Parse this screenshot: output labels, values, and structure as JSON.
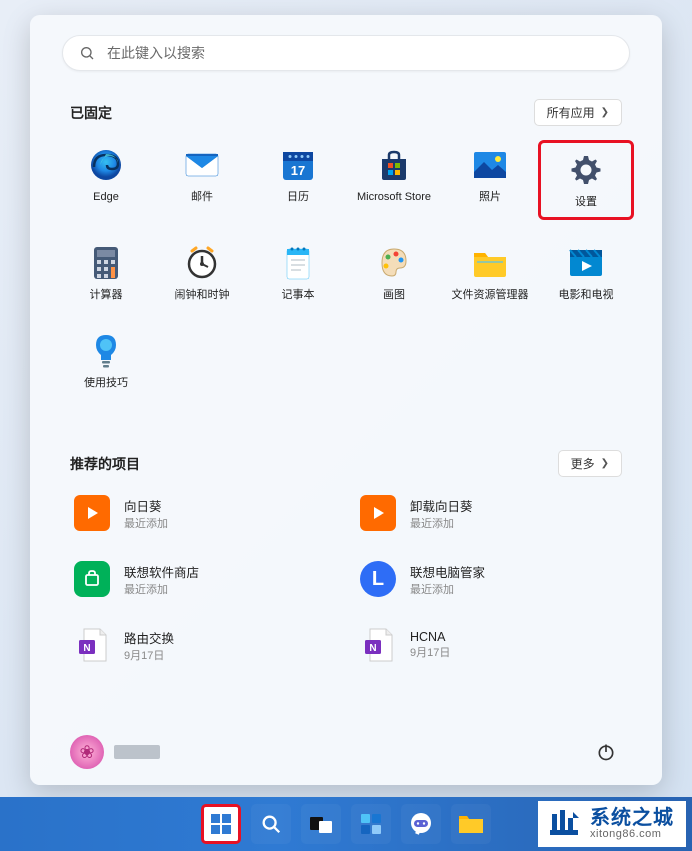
{
  "search": {
    "placeholder": "在此键入以搜索"
  },
  "pinned": {
    "title": "已固定",
    "all_apps_label": "所有应用",
    "apps": [
      "Edge",
      "邮件",
      "日历",
      "Microsoft Store",
      "照片",
      "设置",
      "计算器",
      "闹钟和时钟",
      "记事本",
      "画图",
      "文件资源管理器",
      "电影和电视",
      "使用技巧"
    ]
  },
  "recommended": {
    "title": "推荐的项目",
    "more_label": "更多",
    "items": [
      {
        "title": "向日葵",
        "sub": "最近添加"
      },
      {
        "title": "卸载向日葵",
        "sub": "最近添加"
      },
      {
        "title": "联想软件商店",
        "sub": "最近添加"
      },
      {
        "title": "联想电脑管家",
        "sub": "最近添加"
      },
      {
        "title": "路由交换",
        "sub": "9月17日"
      },
      {
        "title": "HCNA",
        "sub": "9月17日"
      }
    ]
  },
  "watermark": {
    "title": "系统之城",
    "url": "xitong86.com"
  }
}
